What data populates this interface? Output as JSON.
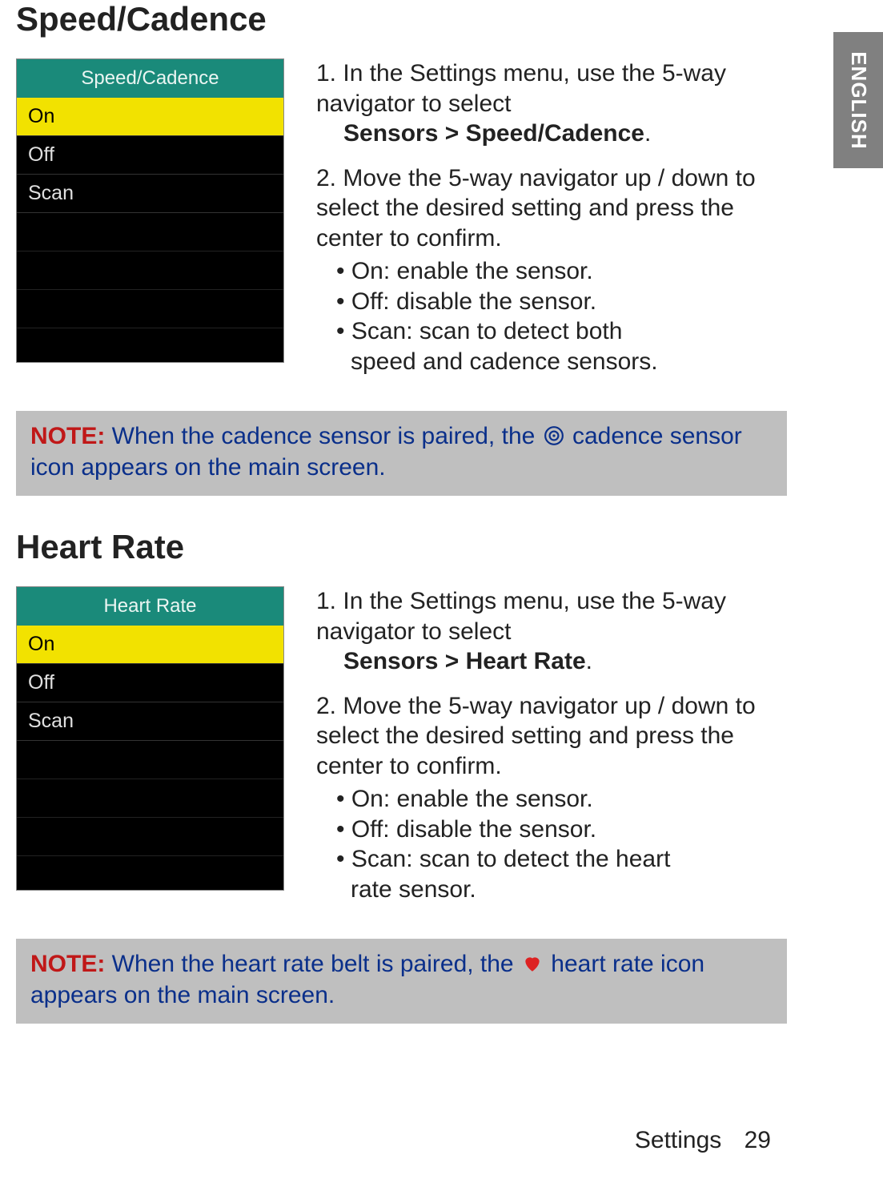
{
  "language_tab": "ENGLISH",
  "section1": {
    "heading": "Speed/Cadence",
    "screenshot": {
      "title": "Speed/Cadence",
      "options": [
        "On",
        "Off",
        "Scan"
      ],
      "selected_index": 0
    },
    "step1_prefix": "In the Settings menu, use the 5-way navigator to select ",
    "step1_bold": "Sensors > Speed/Cadence",
    "step1_suffix": ".",
    "step2": "Move the 5-way navigator up / down to select the desired setting and press the center to confirm.",
    "bullets": {
      "on": "On: enable the sensor.",
      "off": "Off: disable the sensor.",
      "scan_line1": "Scan: scan to detect both",
      "scan_line2": "speed and cadence sensors."
    },
    "note": {
      "label": "NOTE:",
      "before_icon": " When the cadence sensor is paired, the ",
      "after_icon": " cadence sensor icon appears on the main screen."
    }
  },
  "section2": {
    "heading": "Heart Rate",
    "screenshot": {
      "title": "Heart Rate",
      "options": [
        "On",
        "Off",
        "Scan"
      ],
      "selected_index": 0
    },
    "step1_prefix": "In the Settings menu, use the 5-way navigator to select ",
    "step1_bold": "Sensors > Heart Rate",
    "step1_suffix": ".",
    "step2": "Move the 5-way navigator up / down to select the desired setting and press the center to confirm.",
    "bullets": {
      "on": "On: enable the sensor.",
      "off": "Off: disable the sensor.",
      "scan_line1": "Scan: scan to detect the heart",
      "scan_line2": "rate sensor."
    },
    "note": {
      "label": "NOTE:",
      "before_icon": " When the heart rate belt is paired, the ",
      "after_icon": " heart rate icon appears on the main screen."
    }
  },
  "footer": {
    "section": "Settings",
    "page": "29"
  }
}
